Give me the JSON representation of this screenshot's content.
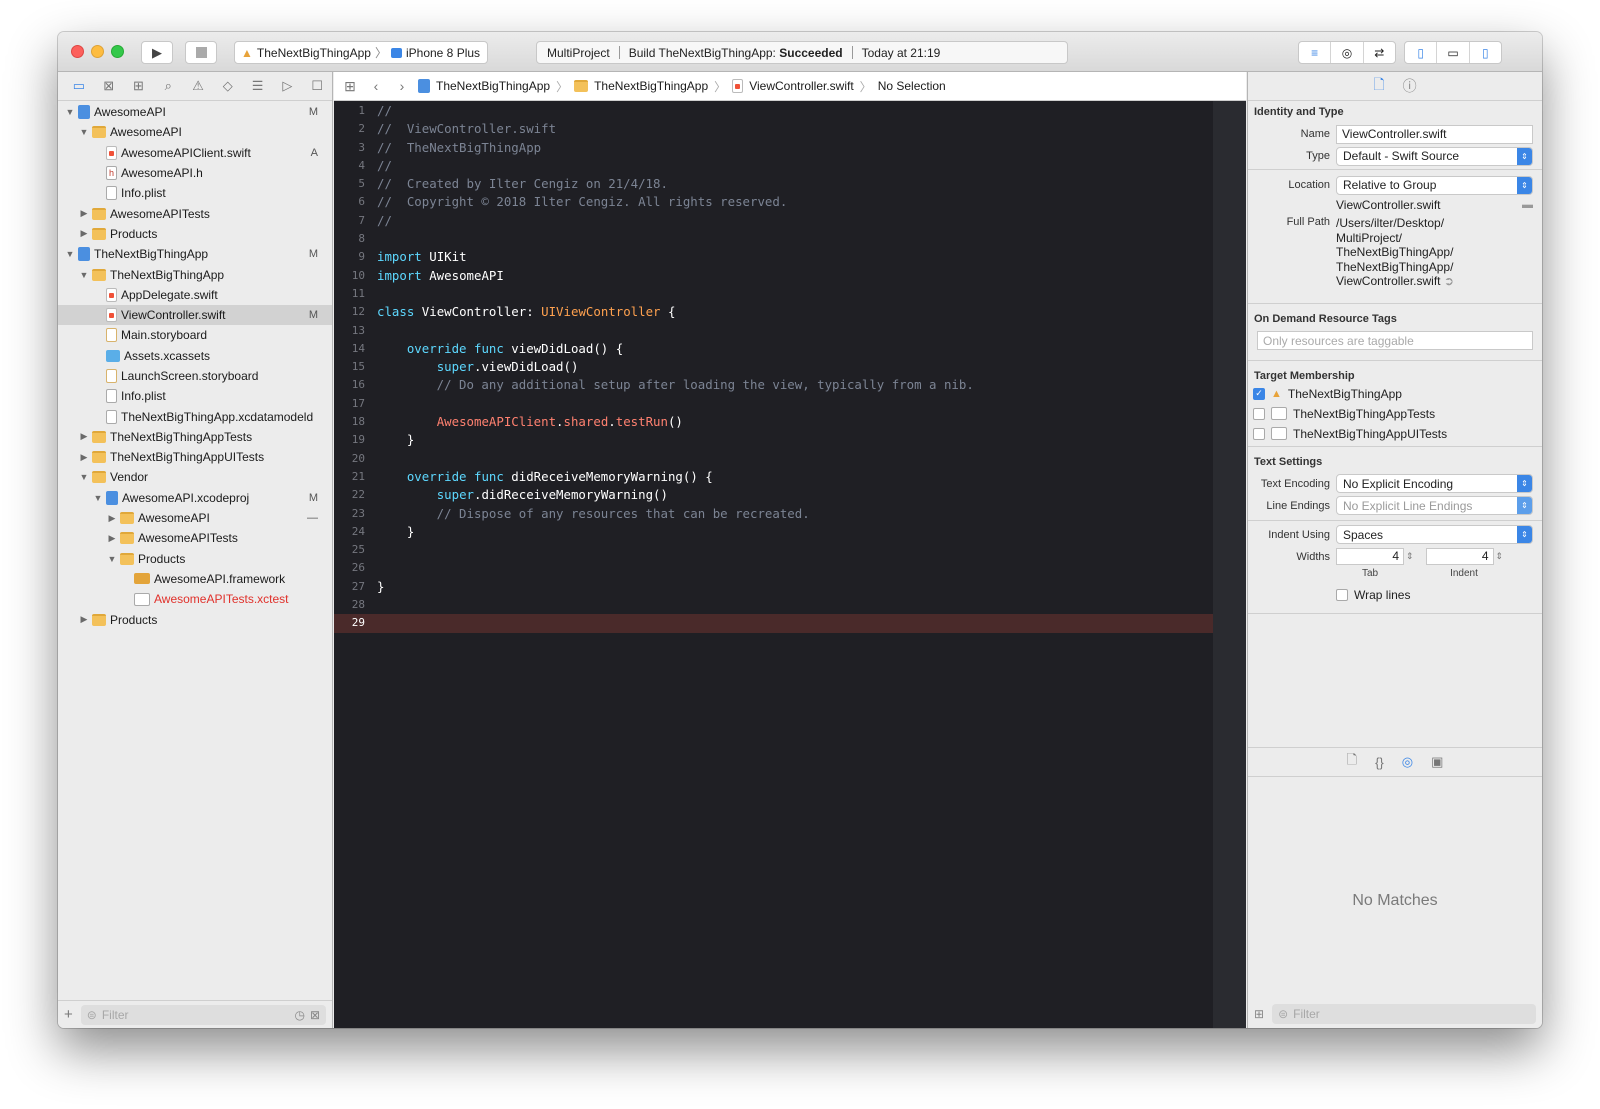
{
  "toolbar": {
    "scheme_app": "TheNextBigThingApp",
    "scheme_device": "iPhone 8 Plus",
    "activity_project": "MultiProject",
    "activity_build_prefix": "Build TheNextBigThingApp:",
    "activity_build_status": "Succeeded",
    "activity_time": "Today at 21:19"
  },
  "navigator": {
    "tree": [
      {
        "label": "AwesomeAPI",
        "indent": 0,
        "icon": "project-icon",
        "expanded": true,
        "badge": "M"
      },
      {
        "label": "AwesomeAPI",
        "indent": 1,
        "icon": "folder-icon",
        "expanded": true,
        "badge": ""
      },
      {
        "label": "AwesomeAPIClient.swift",
        "indent": 2,
        "icon": "swift-file-icon",
        "expanded": null,
        "badge": "A"
      },
      {
        "label": "AwesomeAPI.h",
        "indent": 2,
        "icon": "header-file-icon",
        "expanded": null,
        "badge": ""
      },
      {
        "label": "Info.plist",
        "indent": 2,
        "icon": "plist-file-icon",
        "expanded": null,
        "badge": ""
      },
      {
        "label": "AwesomeAPITests",
        "indent": 1,
        "icon": "folder-icon",
        "expanded": false,
        "badge": ""
      },
      {
        "label": "Products",
        "indent": 1,
        "icon": "folder-icon",
        "expanded": false,
        "badge": ""
      },
      {
        "label": "TheNextBigThingApp",
        "indent": 0,
        "icon": "project-icon",
        "expanded": true,
        "badge": "M"
      },
      {
        "label": "TheNextBigThingApp",
        "indent": 1,
        "icon": "folder-icon",
        "expanded": true,
        "badge": ""
      },
      {
        "label": "AppDelegate.swift",
        "indent": 2,
        "icon": "swift-file-icon",
        "expanded": null,
        "badge": ""
      },
      {
        "label": "ViewController.swift",
        "indent": 2,
        "icon": "swift-file-icon",
        "expanded": null,
        "badge": "M",
        "selected": true
      },
      {
        "label": "Main.storyboard",
        "indent": 2,
        "icon": "storyboard-file-icon",
        "expanded": null,
        "badge": ""
      },
      {
        "label": "Assets.xcassets",
        "indent": 2,
        "icon": "asset-catalog-icon",
        "expanded": null,
        "badge": ""
      },
      {
        "label": "LaunchScreen.storyboard",
        "indent": 2,
        "icon": "storyboard-file-icon",
        "expanded": null,
        "badge": ""
      },
      {
        "label": "Info.plist",
        "indent": 2,
        "icon": "plist-file-icon",
        "expanded": null,
        "badge": ""
      },
      {
        "label": "TheNextBigThingApp.xcdatamodeld",
        "indent": 2,
        "icon": "datamodel-file-icon",
        "expanded": null,
        "badge": ""
      },
      {
        "label": "TheNextBigThingAppTests",
        "indent": 1,
        "icon": "folder-icon",
        "expanded": false,
        "badge": ""
      },
      {
        "label": "TheNextBigThingAppUITests",
        "indent": 1,
        "icon": "folder-icon",
        "expanded": false,
        "badge": ""
      },
      {
        "label": "Vendor",
        "indent": 1,
        "icon": "folder-icon",
        "expanded": true,
        "badge": ""
      },
      {
        "label": "AwesomeAPI.xcodeproj",
        "indent": 2,
        "icon": "project-icon",
        "expanded": true,
        "badge": "M"
      },
      {
        "label": "AwesomeAPI",
        "indent": 3,
        "icon": "folder-icon",
        "expanded": false,
        "badge": "—"
      },
      {
        "label": "AwesomeAPITests",
        "indent": 3,
        "icon": "folder-icon",
        "expanded": false,
        "badge": ""
      },
      {
        "label": "Products",
        "indent": 3,
        "icon": "folder-icon",
        "expanded": true,
        "badge": ""
      },
      {
        "label": "AwesomeAPI.framework",
        "indent": 4,
        "icon": "framework-icon",
        "expanded": null,
        "badge": ""
      },
      {
        "label": "AwesomeAPITests.xctest",
        "indent": 4,
        "icon": "xctest-icon",
        "expanded": null,
        "badge": "",
        "missing": true
      },
      {
        "label": "Products",
        "indent": 1,
        "icon": "folder-icon",
        "expanded": false,
        "badge": ""
      }
    ],
    "filter_placeholder": "Filter"
  },
  "jumpbar": {
    "crumbs": [
      "TheNextBigThingApp",
      "TheNextBigThingApp",
      "ViewController.swift",
      "No Selection"
    ]
  },
  "editor": {
    "current_line": 29,
    "lines": [
      {
        "n": "1",
        "t": [
          [
            "cmt",
            "//"
          ]
        ]
      },
      {
        "n": "2",
        "t": [
          [
            "cmt",
            "//  ViewController.swift"
          ]
        ]
      },
      {
        "n": "3",
        "t": [
          [
            "cmt",
            "//  TheNextBigThingApp"
          ]
        ]
      },
      {
        "n": "4",
        "t": [
          [
            "cmt",
            "//"
          ]
        ]
      },
      {
        "n": "5",
        "t": [
          [
            "cmt",
            "//  Created by Ilter Cengiz on 21/4/18."
          ]
        ]
      },
      {
        "n": "6",
        "t": [
          [
            "cmt",
            "//  Copyright © 2018 Ilter Cengiz. All rights reserved."
          ]
        ]
      },
      {
        "n": "7",
        "t": [
          [
            "cmt",
            "//"
          ]
        ]
      },
      {
        "n": "8",
        "t": []
      },
      {
        "n": "9",
        "t": [
          [
            "kw2",
            "import"
          ],
          [
            "",
            "UIKit"
          ]
        ]
      },
      {
        "n": "10",
        "t": [
          [
            "kw2",
            "import"
          ],
          [
            "",
            " AwesomeAPI"
          ]
        ]
      },
      {
        "n": "11",
        "t": []
      },
      {
        "n": "12",
        "t": [
          [
            "kw2",
            "class"
          ],
          [
            "",
            " ViewController: "
          ],
          [
            "typ",
            "UIViewController"
          ],
          [
            "",
            " {"
          ]
        ]
      },
      {
        "n": "13",
        "t": []
      },
      {
        "n": "14",
        "t": [
          [
            "",
            "    "
          ],
          [
            "kw2",
            "override func"
          ],
          [
            "",
            " viewDidLoad() {"
          ]
        ]
      },
      {
        "n": "15",
        "t": [
          [
            "",
            "        "
          ],
          [
            "kw2",
            "super"
          ],
          [
            "",
            ".viewDidLoad()"
          ]
        ]
      },
      {
        "n": "16",
        "t": [
          [
            "cmt",
            "        // Do any additional setup after loading the view, typically from a nib."
          ]
        ]
      },
      {
        "n": "17",
        "t": []
      },
      {
        "n": "18",
        "t": [
          [
            "",
            "        "
          ],
          [
            "fn",
            "AwesomeAPIClient"
          ],
          [
            "",
            "."
          ],
          [
            "fn",
            "shared"
          ],
          [
            "",
            "."
          ],
          [
            "fn",
            "testRun"
          ],
          [
            "",
            "()"
          ]
        ]
      },
      {
        "n": "19",
        "t": [
          [
            "",
            "    }"
          ]
        ]
      },
      {
        "n": "20",
        "t": []
      },
      {
        "n": "21",
        "t": [
          [
            "",
            "    "
          ],
          [
            "kw2",
            "override func"
          ],
          [
            "",
            " didReceiveMemoryWarning() {"
          ]
        ]
      },
      {
        "n": "22",
        "t": [
          [
            "",
            "        "
          ],
          [
            "kw2",
            "super"
          ],
          [
            "",
            ".didReceiveMemoryWarning()"
          ]
        ]
      },
      {
        "n": "23",
        "t": [
          [
            "cmt",
            "        // Dispose of any resources that can be recreated."
          ]
        ]
      },
      {
        "n": "24",
        "t": [
          [
            "",
            "    }"
          ]
        ]
      },
      {
        "n": "25",
        "t": []
      },
      {
        "n": "26",
        "t": []
      },
      {
        "n": "27",
        "t": [
          [
            "",
            "}"
          ]
        ]
      },
      {
        "n": "28",
        "t": []
      },
      {
        "n": "29",
        "t": []
      }
    ]
  },
  "inspector": {
    "identity_heading": "Identity and Type",
    "name_label": "Name",
    "name_value": "ViewController.swift",
    "type_label": "Type",
    "type_value": "Default - Swift Source",
    "location_label": "Location",
    "location_value": "Relative to Group",
    "location_file": "ViewController.swift",
    "fullpath_label": "Full Path",
    "fullpath_lines": [
      "/Users/ilter/Desktop/",
      "MultiProject/",
      "TheNextBigThingApp/",
      "TheNextBigThingApp/",
      "ViewController.swift"
    ],
    "odr_heading": "On Demand Resource Tags",
    "odr_placeholder": "Only resources are taggable",
    "target_heading": "Target Membership",
    "targets": [
      {
        "label": "TheNextBigThingApp",
        "checked": true
      },
      {
        "label": "TheNextBigThingAppTests",
        "checked": false
      },
      {
        "label": "TheNextBigThingAppUITests",
        "checked": false
      }
    ],
    "text_heading": "Text Settings",
    "encoding_label": "Text Encoding",
    "encoding_value": "No Explicit Encoding",
    "endings_label": "Line Endings",
    "endings_value": "No Explicit Line Endings",
    "indent_label": "Indent Using",
    "indent_value": "Spaces",
    "widths_label": "Widths",
    "tab_value": "4",
    "indent_width_value": "4",
    "tab_caption": "Tab",
    "indent_caption": "Indent",
    "wrap_label": "Wrap lines",
    "no_matches": "No Matches",
    "filter_placeholder": "Filter"
  },
  "colors": {
    "editor_bg": "#1f1f24",
    "keyword": "#5dd8ff",
    "type": "#ffa14f",
    "identifier": "#ff8170",
    "comment": "#7c8494",
    "current_line": "#4a2a2a",
    "accent": "#3b86e6"
  }
}
